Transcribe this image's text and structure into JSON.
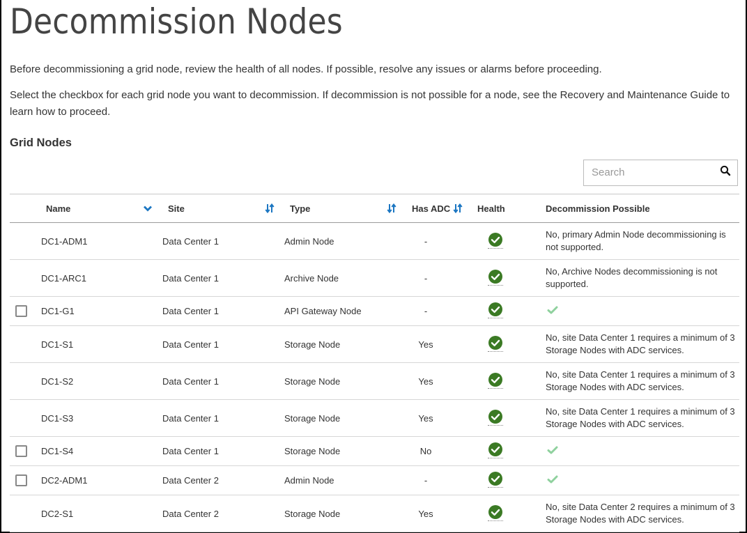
{
  "page": {
    "title": "Decommission Nodes",
    "intro_1": "Before decommissioning a grid node, review the health of all nodes. If possible, resolve any issues or alarms before proceeding.",
    "intro_2": "Select the checkbox for each grid node you want to decommission. If decommission is not possible for a node, see the Recovery and Maintenance Guide to learn how to proceed.",
    "section_title": "Grid Nodes"
  },
  "search": {
    "placeholder": "Search",
    "value": "",
    "icon": "search-icon"
  },
  "colors": {
    "accent": "#1b76c2",
    "health_ok": "#3b7a24",
    "decommission_ok": "#8fd19e"
  },
  "table": {
    "columns": [
      {
        "key": "name",
        "label": "Name",
        "sort_icon": "chevron-down-icon"
      },
      {
        "key": "site",
        "label": "Site",
        "sort_icon": "sort-arrows-icon"
      },
      {
        "key": "type",
        "label": "Type",
        "sort_icon": "sort-arrows-icon"
      },
      {
        "key": "has_adc",
        "label": "Has ADC",
        "sort_icon": "sort-arrows-icon"
      },
      {
        "key": "health",
        "label": "Health"
      },
      {
        "key": "decommission_possible",
        "label": "Decommission Possible"
      }
    ],
    "rows": [
      {
        "selectable": false,
        "name": "DC1-ADM1",
        "site": "Data Center 1",
        "type": "Admin Node",
        "has_adc": "-",
        "health": "ok",
        "decommission_possible": "No, primary Admin Node decommissioning is not supported."
      },
      {
        "selectable": false,
        "name": "DC1-ARC1",
        "site": "Data Center 1",
        "type": "Archive Node",
        "has_adc": "-",
        "health": "ok",
        "decommission_possible": "No, Archive Nodes decommissioning is not supported."
      },
      {
        "selectable": true,
        "checked": false,
        "name": "DC1-G1",
        "site": "Data Center 1",
        "type": "API Gateway Node",
        "has_adc": "-",
        "health": "ok",
        "decommission_possible": ""
      },
      {
        "selectable": false,
        "name": "DC1-S1",
        "site": "Data Center 1",
        "type": "Storage Node",
        "has_adc": "Yes",
        "health": "ok",
        "decommission_possible": "No, site Data Center 1 requires a minimum of 3 Storage Nodes with ADC services."
      },
      {
        "selectable": false,
        "name": "DC1-S2",
        "site": "Data Center 1",
        "type": "Storage Node",
        "has_adc": "Yes",
        "health": "ok",
        "decommission_possible": "No, site Data Center 1 requires a minimum of 3 Storage Nodes with ADC services."
      },
      {
        "selectable": false,
        "name": "DC1-S3",
        "site": "Data Center 1",
        "type": "Storage Node",
        "has_adc": "Yes",
        "health": "ok",
        "decommission_possible": "No, site Data Center 1 requires a minimum of 3 Storage Nodes with ADC services."
      },
      {
        "selectable": true,
        "checked": false,
        "name": "DC1-S4",
        "site": "Data Center 1",
        "type": "Storage Node",
        "has_adc": "No",
        "health": "ok",
        "decommission_possible": ""
      },
      {
        "selectable": true,
        "checked": false,
        "name": "DC2-ADM1",
        "site": "Data Center 2",
        "type": "Admin Node",
        "has_adc": "-",
        "health": "ok",
        "decommission_possible": ""
      },
      {
        "selectable": false,
        "name": "DC2-S1",
        "site": "Data Center 2",
        "type": "Storage Node",
        "has_adc": "Yes",
        "health": "ok",
        "decommission_possible": "No, site Data Center 2 requires a minimum of 3 Storage Nodes with ADC services."
      }
    ]
  }
}
